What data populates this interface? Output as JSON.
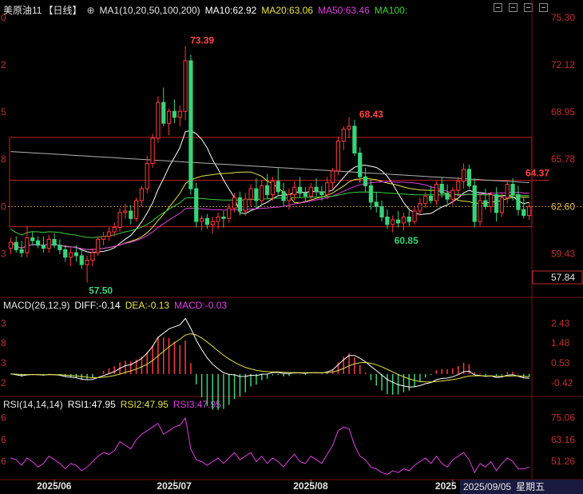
{
  "header": {
    "main": {
      "symbol": "美原油11",
      "period": "【日线】",
      "gear_icon": "settings-icon",
      "ma_label": "MA1(10,20,50,100,200)",
      "items": [
        {
          "text": "MA10:62.92",
          "color": "#ffffff"
        },
        {
          "text": "MA20:63.06",
          "color": "#e6e24a"
        },
        {
          "text": "MA50:63.46",
          "color": "#e040e0"
        },
        {
          "text": "MA100:",
          "color": "#3ad23a"
        }
      ]
    },
    "macd": {
      "label": "MACD(26,12,9)",
      "items": [
        {
          "text": "DIFF:-0.14",
          "color": "#ffffff"
        },
        {
          "text": "DEA:-0.13",
          "color": "#e6e24a"
        },
        {
          "text": "MACD:-0.03",
          "color": "#e040e0"
        }
      ]
    },
    "rsi": {
      "label": "RSI(14,14,14)",
      "items": [
        {
          "text": "RSI1:47.95",
          "color": "#ffffff"
        },
        {
          "text": "RSI2:47.95",
          "color": "#e6e24a"
        },
        {
          "text": "RSI3:47.95",
          "color": "#e040e0"
        }
      ]
    },
    "window_icons": [
      "restore-icon",
      "minimize-icon",
      "maximize-icon",
      "close-icon"
    ]
  },
  "chart_data": {
    "type": "candlestick",
    "price_axis": {
      "ylim": [
        56.5,
        75.3
      ],
      "ticks": [
        "75.30",
        "72.12",
        "68.95",
        "65.78",
        "62.60",
        "59.43"
      ],
      "tick_values": [
        75.3,
        72.12,
        68.95,
        65.78,
        62.6,
        59.43
      ],
      "left_ticks": [
        "0",
        "2",
        "5",
        "8",
        "0",
        "3"
      ],
      "current_price": "62.60",
      "low_box": "57.84",
      "low_box_value": 57.84
    },
    "annotations": [
      {
        "text": "73.39",
        "value": 73.39,
        "color": "#ff4444"
      },
      {
        "text": "68.43",
        "value": 68.43,
        "color": "#ff4444"
      },
      {
        "text": "64.37",
        "value": 64.37,
        "color": "#ff4444"
      },
      {
        "text": "60.85",
        "value": 60.85,
        "color": "#3ad27a"
      },
      {
        "text": "57.50",
        "value": 57.5,
        "color": "#3ad27a"
      }
    ],
    "levels": [
      64.37,
      61.25,
      67.25
    ],
    "candles": [
      [
        59.8,
        60.5,
        59.4,
        60.2
      ],
      [
        60.2,
        60.6,
        59.5,
        59.7
      ],
      [
        59.7,
        60.3,
        59.2,
        59.5
      ],
      [
        59.5,
        61.3,
        59.2,
        60.5
      ],
      [
        60.5,
        60.9,
        60.0,
        60.3
      ],
      [
        60.3,
        60.6,
        59.8,
        60.0
      ],
      [
        60.0,
        60.6,
        59.5,
        59.8
      ],
      [
        59.8,
        60.7,
        59.5,
        60.4
      ],
      [
        60.4,
        60.8,
        59.8,
        60.0
      ],
      [
        60.0,
        60.4,
        59.4,
        59.7
      ],
      [
        59.7,
        60.0,
        58.9,
        59.2
      ],
      [
        59.2,
        59.8,
        58.6,
        59.5
      ],
      [
        59.5,
        60.0,
        58.9,
        59.3
      ],
      [
        59.3,
        59.7,
        58.4,
        58.7
      ],
      [
        58.7,
        59.3,
        57.5,
        59.0
      ],
      [
        59.0,
        59.8,
        58.6,
        59.5
      ],
      [
        59.5,
        60.6,
        59.3,
        60.4
      ],
      [
        60.4,
        60.9,
        60.0,
        60.6
      ],
      [
        60.6,
        61.2,
        60.3,
        60.9
      ],
      [
        60.9,
        61.5,
        60.6,
        61.2
      ],
      [
        61.2,
        62.5,
        60.9,
        62.2
      ],
      [
        62.2,
        62.8,
        61.8,
        62.3
      ],
      [
        62.3,
        62.7,
        61.4,
        61.8
      ],
      [
        61.8,
        63.2,
        61.6,
        63.0
      ],
      [
        63.0,
        64.0,
        62.6,
        63.8
      ],
      [
        63.8,
        66.0,
        63.5,
        65.5
      ],
      [
        65.5,
        67.5,
        65.2,
        67.2
      ],
      [
        67.2,
        70.0,
        66.9,
        69.6
      ],
      [
        69.6,
        70.6,
        68.0,
        68.2
      ],
      [
        68.2,
        69.2,
        67.4,
        69.0
      ],
      [
        69.0,
        69.8,
        68.2,
        68.6
      ],
      [
        68.6,
        69.4,
        68.0,
        69.0
      ],
      [
        69.0,
        73.39,
        68.4,
        72.4
      ],
      [
        72.4,
        72.8,
        63.4,
        63.8
      ],
      [
        63.8,
        64.2,
        61.2,
        61.6
      ],
      [
        61.6,
        62.0,
        61.0,
        61.8
      ],
      [
        61.8,
        62.1,
        61.1,
        61.4
      ],
      [
        61.4,
        61.9,
        60.8,
        61.6
      ],
      [
        61.6,
        62.2,
        61.1,
        61.9
      ],
      [
        61.9,
        62.3,
        61.2,
        61.8
      ],
      [
        61.8,
        62.8,
        61.5,
        62.5
      ],
      [
        62.5,
        63.5,
        62.2,
        63.2
      ],
      [
        63.2,
        63.6,
        62.0,
        62.3
      ],
      [
        62.3,
        63.5,
        62.0,
        63.1
      ],
      [
        63.1,
        64.1,
        62.6,
        63.8
      ],
      [
        63.8,
        64.5,
        62.5,
        63.0
      ],
      [
        63.0,
        64.4,
        62.7,
        64.0
      ],
      [
        64.0,
        64.8,
        63.1,
        63.4
      ],
      [
        63.4,
        64.6,
        63.0,
        64.3
      ],
      [
        64.3,
        65.2,
        63.3,
        63.6
      ],
      [
        63.6,
        64.2,
        62.6,
        63.0
      ],
      [
        63.0,
        63.8,
        62.4,
        63.4
      ],
      [
        63.4,
        64.3,
        63.0,
        63.9
      ],
      [
        63.9,
        64.6,
        63.2,
        63.5
      ],
      [
        63.5,
        63.9,
        62.9,
        63.3
      ],
      [
        63.3,
        64.2,
        63.0,
        63.9
      ],
      [
        63.9,
        64.5,
        63.3,
        63.6
      ],
      [
        63.6,
        64.0,
        63.0,
        63.4
      ],
      [
        63.4,
        64.6,
        63.1,
        64.2
      ],
      [
        64.2,
        65.2,
        63.8,
        65.0
      ],
      [
        65.0,
        67.3,
        64.7,
        67.0
      ],
      [
        67.0,
        68.0,
        66.4,
        67.8
      ],
      [
        67.8,
        68.6,
        67.2,
        68.0
      ],
      [
        68.0,
        68.43,
        66.0,
        66.2
      ],
      [
        66.2,
        66.6,
        64.2,
        64.6
      ],
      [
        64.6,
        65.2,
        63.6,
        64.0
      ],
      [
        64.0,
        64.5,
        62.4,
        62.9
      ],
      [
        62.9,
        63.6,
        62.2,
        62.6
      ],
      [
        62.6,
        63.0,
        61.6,
        61.9
      ],
      [
        61.9,
        62.4,
        61.1,
        61.4
      ],
      [
        61.4,
        62.0,
        60.85,
        61.7
      ],
      [
        61.7,
        62.3,
        61.2,
        61.5
      ],
      [
        61.5,
        62.2,
        61.0,
        61.9
      ],
      [
        61.9,
        62.5,
        61.3,
        61.6
      ],
      [
        61.6,
        62.6,
        61.4,
        62.3
      ],
      [
        62.3,
        63.2,
        62.0,
        62.8
      ],
      [
        62.8,
        63.6,
        62.5,
        63.3
      ],
      [
        63.3,
        64.0,
        62.8,
        63.0
      ],
      [
        63.0,
        64.3,
        62.7,
        64.1
      ],
      [
        64.1,
        64.6,
        63.2,
        63.5
      ],
      [
        63.5,
        64.1,
        62.8,
        63.1
      ],
      [
        63.1,
        63.9,
        62.7,
        63.7
      ],
      [
        63.7,
        64.6,
        63.4,
        64.3
      ],
      [
        64.3,
        65.5,
        63.8,
        65.1
      ],
      [
        65.1,
        65.4,
        63.8,
        64.0
      ],
      [
        64.0,
        64.5,
        61.2,
        61.6
      ],
      [
        61.6,
        63.4,
        61.3,
        63.0
      ],
      [
        63.0,
        63.8,
        62.4,
        62.6
      ],
      [
        62.6,
        63.6,
        62.2,
        63.4
      ],
      [
        63.4,
        63.9,
        61.6,
        62.2
      ],
      [
        62.2,
        63.5,
        61.9,
        63.2
      ],
      [
        63.2,
        64.4,
        62.8,
        64.1
      ],
      [
        64.1,
        64.5,
        63.0,
        63.4
      ],
      [
        63.4,
        64.0,
        62.0,
        62.4
      ],
      [
        62.4,
        63.2,
        61.8,
        62.0
      ],
      [
        62.0,
        62.9,
        61.7,
        62.6
      ]
    ],
    "ma_series": [
      {
        "name": "MA10",
        "color": "#ffffff"
      },
      {
        "name": "MA20",
        "color": "#e6e24a"
      },
      {
        "name": "MA50",
        "color": "#e040e0"
      },
      {
        "name": "MA100",
        "color": "#3ad23a"
      },
      {
        "name": "MA200",
        "color": "#b0b0b0"
      }
    ],
    "macd_axis": {
      "ylim": [
        -1.0,
        2.9
      ],
      "ticks": [
        "2.43",
        "1.48",
        "0.53",
        "-0.42"
      ],
      "tick_values": [
        2.43,
        1.48,
        0.53,
        -0.42
      ],
      "left_ticks": [
        "3",
        "8",
        "3",
        "2"
      ]
    },
    "rsi_axis": {
      "ylim": [
        42,
        78
      ],
      "ticks": [
        "75.06",
        "63.16",
        "51.26"
      ],
      "tick_values": [
        75.06,
        63.16,
        51.26
      ],
      "left_ticks": [
        "6",
        "6",
        "6"
      ]
    },
    "rsi_values": [
      53,
      52,
      49,
      53,
      51,
      48,
      50,
      54,
      52,
      50,
      47,
      50,
      49,
      46,
      48,
      51,
      54,
      56,
      55,
      57,
      62,
      60,
      58,
      63,
      66,
      68,
      70,
      72,
      66,
      68,
      70,
      71,
      75,
      58,
      52,
      51,
      49,
      51,
      53,
      50,
      53,
      56,
      52,
      54,
      56,
      51,
      54,
      50,
      53,
      51,
      48,
      52,
      55,
      51,
      50,
      54,
      52,
      50,
      55,
      60,
      68,
      70,
      69,
      60,
      54,
      52,
      48,
      47,
      45,
      44,
      46,
      45,
      47,
      46,
      49,
      51,
      53,
      50,
      54,
      50,
      48,
      52,
      54,
      56,
      52,
      45,
      50,
      48,
      51,
      46,
      50,
      53,
      51,
      47,
      47,
      48
    ],
    "x_labels": [
      "2025/06",
      "2025/07",
      "2025/08",
      "2025"
    ],
    "x_label_index": [
      8,
      30,
      55,
      81
    ],
    "last_date": "2025/09/05",
    "weekday": "星期五"
  }
}
